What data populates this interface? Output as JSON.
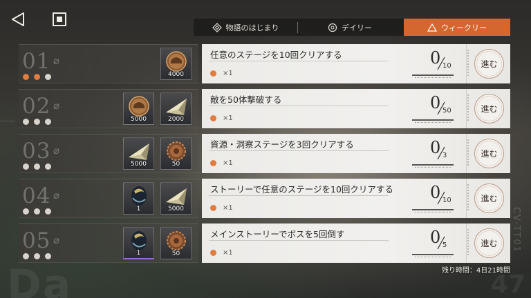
{
  "tabs": {
    "story": "物語のはじまり",
    "daily": "デイリー",
    "weekly": "ウィークリー",
    "active": "weekly",
    "active_color": "#d4662f"
  },
  "icons": {
    "back": "back-arrow-icon",
    "home": "home-square-icon",
    "story_tab": "diamond-icon",
    "daily_tab": "circle-icon",
    "weekly_tab": "triangle-icon"
  },
  "missions": [
    {
      "num": "01",
      "dots_on": 2,
      "rewards": [
        {
          "type": "coin",
          "count": "4000"
        }
      ],
      "task": "任意のステージを10回クリアする",
      "reward_qty": "×1",
      "current": "0",
      "total": "10",
      "go": "進む"
    },
    {
      "num": "02",
      "dots_on": 0,
      "rewards": [
        {
          "type": "coin",
          "count": "5000"
        },
        {
          "type": "shard",
          "count": "2000"
        }
      ],
      "task": "敵を50体撃破する",
      "reward_qty": "×1",
      "current": "0",
      "total": "50",
      "go": "進む"
    },
    {
      "num": "03",
      "dots_on": 0,
      "rewards": [
        {
          "type": "shard",
          "count": "5000"
        },
        {
          "type": "core",
          "count": "50"
        }
      ],
      "task": "資源・洞察ステージを3回クリアする",
      "reward_qty": "×1",
      "current": "0",
      "total": "3",
      "go": "進む"
    },
    {
      "num": "04",
      "dots_on": 0,
      "rewards": [
        {
          "type": "orb",
          "count": "1"
        },
        {
          "type": "shard",
          "count": "5000"
        }
      ],
      "task": "ストーリーで任意のステージを10回クリアする",
      "reward_qty": "×1",
      "current": "0",
      "total": "10",
      "go": "進む"
    },
    {
      "num": "05",
      "dots_on": 0,
      "rewards": [
        {
          "type": "orb-purple",
          "count": "1"
        },
        {
          "type": "core",
          "count": "50"
        }
      ],
      "task": "メインストーリーでボスを5回倒す",
      "reward_qty": "×1",
      "current": "0",
      "total": "5",
      "go": "進む"
    }
  ],
  "time_left": "残り時間：4日21時間",
  "deco": {
    "bg_left": "Da",
    "bg_right": "47",
    "bg_vertical": "CV-TT01"
  }
}
